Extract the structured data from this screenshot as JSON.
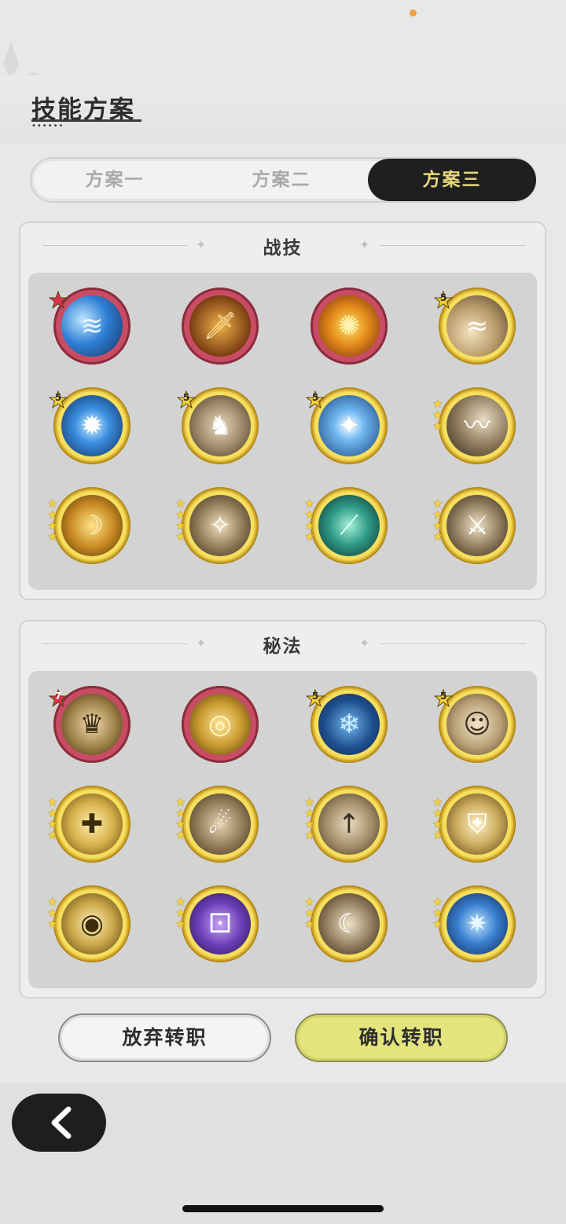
{
  "header": {
    "title": "技能方案"
  },
  "tabs": [
    {
      "label": "方案一",
      "active": false
    },
    {
      "label": "方案二",
      "active": false
    },
    {
      "label": "方案三",
      "active": true
    }
  ],
  "colors": {
    "accent_tab_text": "#e8d97a",
    "confirm_button": "#e3e57c",
    "red_frame": "#c84c63",
    "gold_frame": "#d9b53a"
  },
  "skills_panel": {
    "title": "战技",
    "icons": [
      {
        "name": "water-wave-skill-icon",
        "frame": "red",
        "badge": "star",
        "badge_color": "red",
        "badge_text": ""
      },
      {
        "name": "golden-swords-skill-icon",
        "frame": "red",
        "badge": "",
        "badge_text": ""
      },
      {
        "name": "fire-burst-skill-icon",
        "frame": "red",
        "badge": "",
        "badge_text": ""
      },
      {
        "name": "wind-swirl-skill-icon",
        "frame": "gold",
        "badge": "star",
        "badge_color": "gold",
        "badge_text": "5"
      },
      {
        "name": "blue-vortex-skill-icon",
        "frame": "gold",
        "badge": "star",
        "badge_color": "gold",
        "badge_text": "5"
      },
      {
        "name": "charging-beast-skill-icon",
        "frame": "gold",
        "badge": "star",
        "badge_color": "gold",
        "badge_text": "5"
      },
      {
        "name": "blue-star-skill-icon",
        "frame": "gold",
        "badge": "star",
        "badge_color": "gold",
        "badge_text": "5"
      },
      {
        "name": "wind-slash-skill-icon",
        "frame": "gold",
        "badge": "stars",
        "star_count": 3
      },
      {
        "name": "golden-slash-skill-icon",
        "frame": "gold",
        "badge": "stars",
        "star_count": 4
      },
      {
        "name": "star-orbit-skill-icon",
        "frame": "gold",
        "badge": "stars",
        "star_count": 4
      },
      {
        "name": "green-slash-skill-icon",
        "frame": "gold",
        "badge": "stars",
        "star_count": 4
      },
      {
        "name": "sword-strike-skill-icon",
        "frame": "gold",
        "badge": "stars",
        "star_count": 4
      }
    ]
  },
  "secret_panel": {
    "title": "秘法",
    "icons": [
      {
        "name": "crowned-figures-icon",
        "frame": "red",
        "badge": "star",
        "badge_color": "red",
        "badge_text": "7"
      },
      {
        "name": "golden-ring-icon",
        "frame": "red",
        "badge": "",
        "badge_text": ""
      },
      {
        "name": "snowflake-icon",
        "frame": "gold",
        "badge": "star",
        "badge_color": "gold",
        "badge_text": "5"
      },
      {
        "name": "hooded-figure-icon",
        "frame": "gold",
        "badge": "star",
        "badge_color": "gold",
        "badge_text": "5"
      },
      {
        "name": "healer-icon",
        "frame": "gold",
        "badge": "stars",
        "star_count": 4
      },
      {
        "name": "claw-strike-icon",
        "frame": "gold",
        "badge": "stars",
        "star_count": 4
      },
      {
        "name": "sword-up-icon",
        "frame": "gold",
        "badge": "stars",
        "star_count": 4
      },
      {
        "name": "shield-icon",
        "frame": "gold",
        "badge": "stars",
        "star_count": 4
      },
      {
        "name": "all-seeing-eye-icon",
        "frame": "gold",
        "badge": "stars",
        "star_count": 3
      },
      {
        "name": "purple-dice-icon",
        "frame": "gold",
        "badge": "stars",
        "star_count": 3
      },
      {
        "name": "beast-head-icon",
        "frame": "gold",
        "badge": "stars",
        "star_count": 3
      },
      {
        "name": "ice-crystal-icon",
        "frame": "gold",
        "badge": "stars",
        "star_count": 3
      }
    ]
  },
  "buttons": {
    "abandon": "放弃转职",
    "confirm": "确认转职"
  },
  "back": {
    "icon": "chevron-left-icon"
  }
}
